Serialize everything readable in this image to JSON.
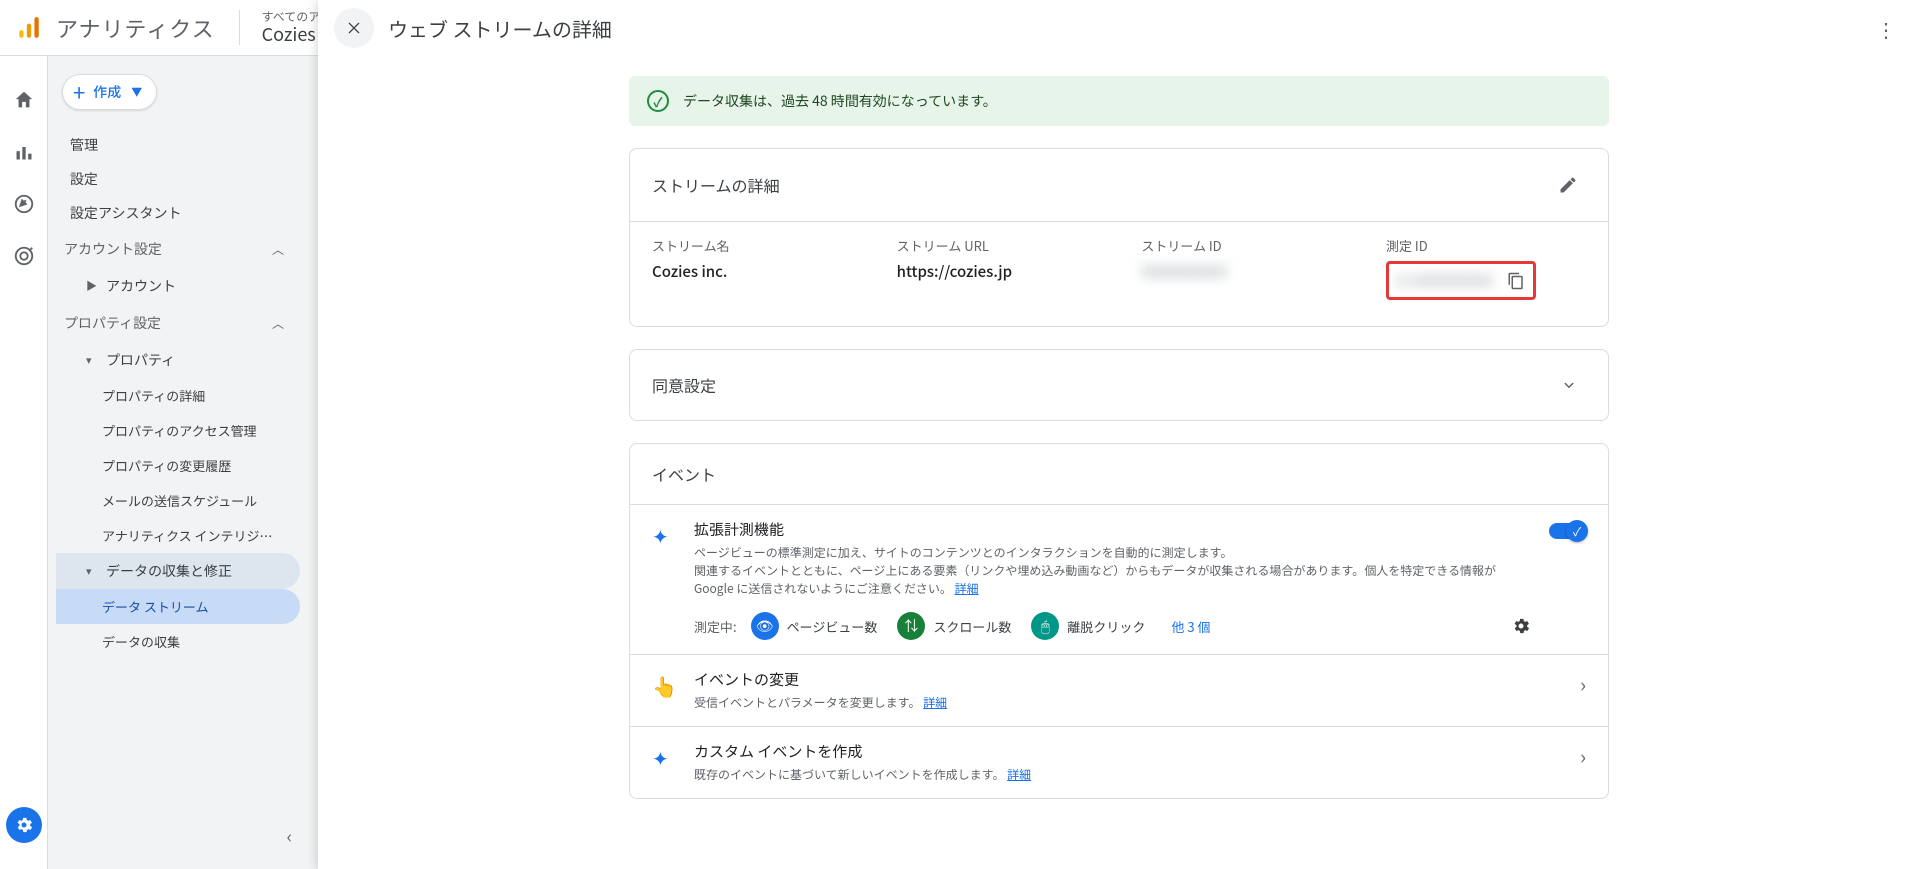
{
  "topbar": {
    "product": "アナリティクス",
    "account_line1": "すべてのアカウン",
    "account_line2": "Cozies in"
  },
  "sidebar": {
    "create": "作成",
    "items": {
      "admin": "管理",
      "settings": "設定",
      "assistant": "設定アシスタント"
    },
    "acct_section": "アカウント設定",
    "account": "アカウント",
    "prop_section": "プロパティ設定",
    "property": "プロパティ",
    "leaves": {
      "details": "プロパティの詳細",
      "access": "プロパティのアクセス管理",
      "history": "プロパティの変更履歴",
      "mail": "メールの送信スケジュール",
      "intel": "アナリティクス インテリジ…"
    },
    "data_group": "データの収集と修正",
    "data_leaves": {
      "streams": "データ ストリーム",
      "collection": "データの収集"
    }
  },
  "sheet": {
    "title": "ウェブ ストリームの詳細",
    "banner": "データ収集は、過去 48 時間有効になっています。",
    "details_title": "ストリームの詳細",
    "cols": {
      "name_lbl": "ストリーム名",
      "name_val": "Cozies inc.",
      "url_lbl": "ストリーム URL",
      "url_val": "https://cozies.jp",
      "id_lbl": "ストリーム ID",
      "id_val": "0000000000",
      "mid_lbl": "測定 ID",
      "mid_val": "G-XXXXXXXXX"
    },
    "consent_title": "同意設定",
    "events_title": "イベント",
    "enhanced": {
      "title": "拡張計測機能",
      "desc1": "ページビューの標準測定に加え、サイトのコンテンツとのインタラクションを自動的に測定します。",
      "desc2": "関連するイベントとともに、ページ上にある要素（リンクや埋め込み動画など）からもデータが収集される場合があります。個人を特定できる情報が Google に送信されないようにご注意ください。",
      "link": "詳細",
      "measuring_lbl": "測定中:",
      "chips": {
        "pv": "ページビュー数",
        "scroll": "スクロール数",
        "out": "離脱クリック"
      },
      "more": "他 3 個"
    },
    "modify": {
      "title": "イベントの変更",
      "desc": "受信イベントとパラメータを変更します。",
      "link": "詳細"
    },
    "custom": {
      "title": "カスタム イベントを作成",
      "desc": "既存のイベントに基づいて新しいイベントを作成します。",
      "link": "詳細"
    }
  }
}
